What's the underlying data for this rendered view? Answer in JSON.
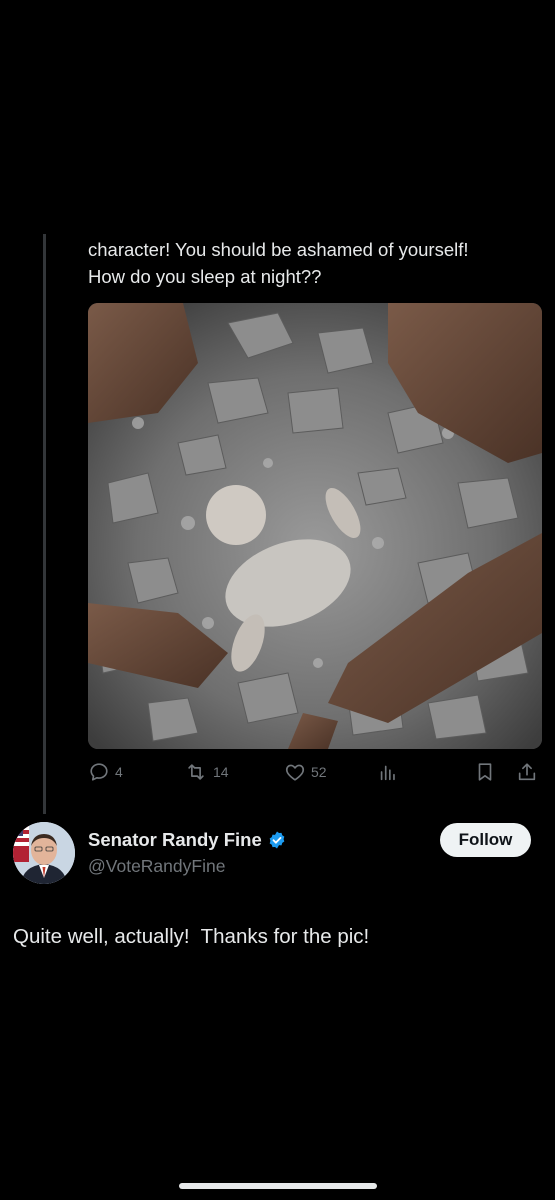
{
  "parent_post": {
    "text_line_1": "character! You should be ashamed of yourself!",
    "text_line_2": "How do you sleep at night??",
    "media_alt": "Photo",
    "actions": {
      "reply_count": "4",
      "repost_count": "14",
      "like_count": "52"
    }
  },
  "reply_post": {
    "display_name": "Senator Randy Fine",
    "handle": "@VoteRandyFine",
    "verified": true,
    "follow_label": "Follow",
    "text": "Quite well, actually!  Thanks for the pic!"
  },
  "colors": {
    "background": "#000000",
    "text": "#e7e9ea",
    "muted": "#71767b",
    "verified_badge": "#1d9bf0",
    "follow_button_bg": "#eff3f4"
  }
}
